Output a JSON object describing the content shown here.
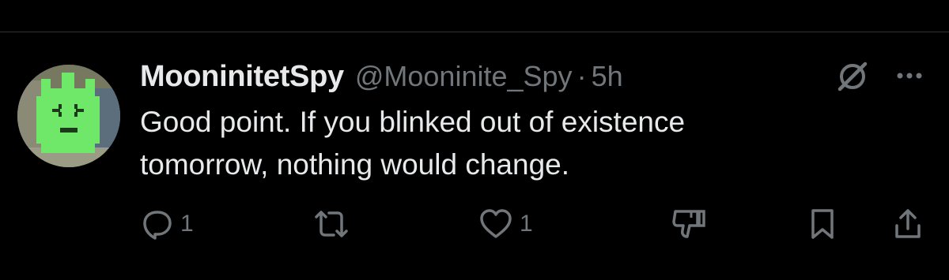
{
  "tweet": {
    "display_name": "MooninitetSpy",
    "handle": "@Mooninite_Spy",
    "separator": "·",
    "time": "5h",
    "text_line1": "Good point. If you blinked out of existence",
    "text_line2": "tomorrow, nothing would change.",
    "avatar": "green-pixel-moonite-character"
  },
  "actions": {
    "reply_count": "1",
    "like_count": "1"
  },
  "icons": {
    "grok": "grok-icon",
    "more": "more-icon",
    "reply": "reply-icon",
    "repost": "repost-icon",
    "like": "heart-icon",
    "dislike": "dislike-icon",
    "bookmark": "bookmark-icon",
    "share": "share-icon"
  },
  "colors": {
    "background": "#000000",
    "primary_text": "#e7e9ea",
    "secondary_text": "#71767b",
    "divider": "#2f3336",
    "avatar_green": "#6fe86a"
  }
}
